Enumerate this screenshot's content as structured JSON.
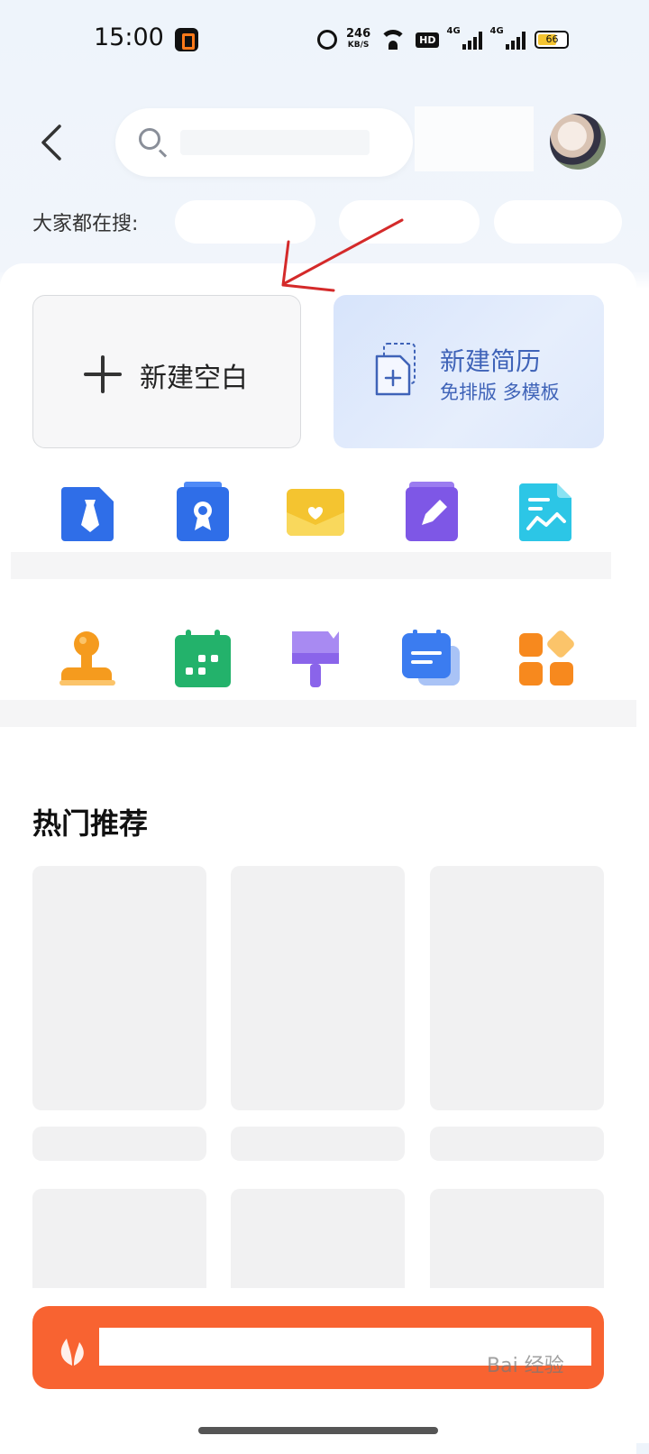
{
  "status_bar": {
    "time": "15:00",
    "network_speed_value": "246",
    "network_speed_unit": "KB/S",
    "hd_label": "HD",
    "signal1_label": "4G",
    "signal2_label": "4G",
    "battery_level": "66",
    "battery_fraction": 0.66
  },
  "header": {
    "search_placeholder": "",
    "trending_label": "大家都在搜:",
    "trending_tags": [
      "",
      "",
      ""
    ]
  },
  "create": {
    "blank_label": "新建空白",
    "resume_title": "新建简历",
    "resume_subtitle": "免排版 多模板"
  },
  "tools": {
    "row1": [
      "tie-document-icon",
      "certificate-icon",
      "heart-envelope-icon",
      "pencil-note-icon",
      "chart-document-icon"
    ],
    "row2": [
      "stamp-icon",
      "calendar-icon",
      "paint-brush-icon",
      "cards-icon",
      "apps-grid-icon"
    ]
  },
  "hot": {
    "title": "热门推荐"
  },
  "banner": {
    "text": ""
  },
  "watermark": "Bai 经验",
  "colors": {
    "accent_blue": "#3f63b8",
    "banner_orange": "#f86331",
    "arrow_red": "#d42a2a"
  }
}
